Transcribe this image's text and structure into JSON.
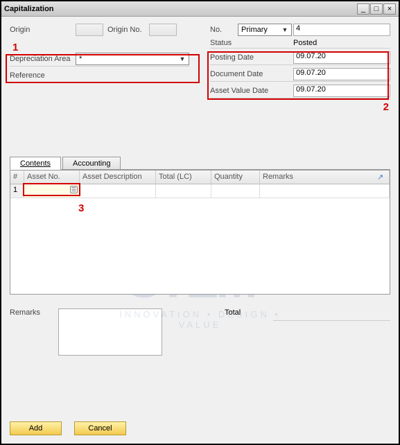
{
  "window": {
    "title": "Capitalization"
  },
  "header": {
    "origin_label": "Origin",
    "origin_value": "",
    "origin_no_label": "Origin No.",
    "origin_no_value": "",
    "no_label": "No.",
    "no_selector": "Primary",
    "no_value": "4",
    "status_label": "Status",
    "status_value": "Posted",
    "posting_date_label": "Posting Date",
    "posting_date_value": "09.07.20",
    "document_date_label": "Document Date",
    "document_date_value": "09.07.20",
    "asset_value_date_label": "Asset Value Date",
    "asset_value_date_value": "09.07.20",
    "depr_area_label": "Depreciation Area",
    "depr_area_value": "*",
    "reference_label": "Reference",
    "reference_value": ""
  },
  "tabs": {
    "contents": "Contents",
    "accounting": "Accounting"
  },
  "grid": {
    "cols": {
      "idx": "#",
      "asset_no": "Asset No.",
      "asset_desc": "Asset Description",
      "total_lc": "Total (LC)",
      "quantity": "Quantity",
      "remarks": "Remarks"
    },
    "row1": {
      "idx": "1",
      "asset_no": ""
    }
  },
  "footer": {
    "remarks_label": "Remarks",
    "remarks_value": "",
    "total_label": "Total",
    "total_value": "",
    "add": "Add",
    "cancel": "Cancel"
  },
  "annotations": {
    "a1": "1",
    "a2": "2",
    "a3": "3"
  },
  "watermark": {
    "main": "STEM",
    "tag": "INNOVATION • DESIGN • VALUE"
  }
}
